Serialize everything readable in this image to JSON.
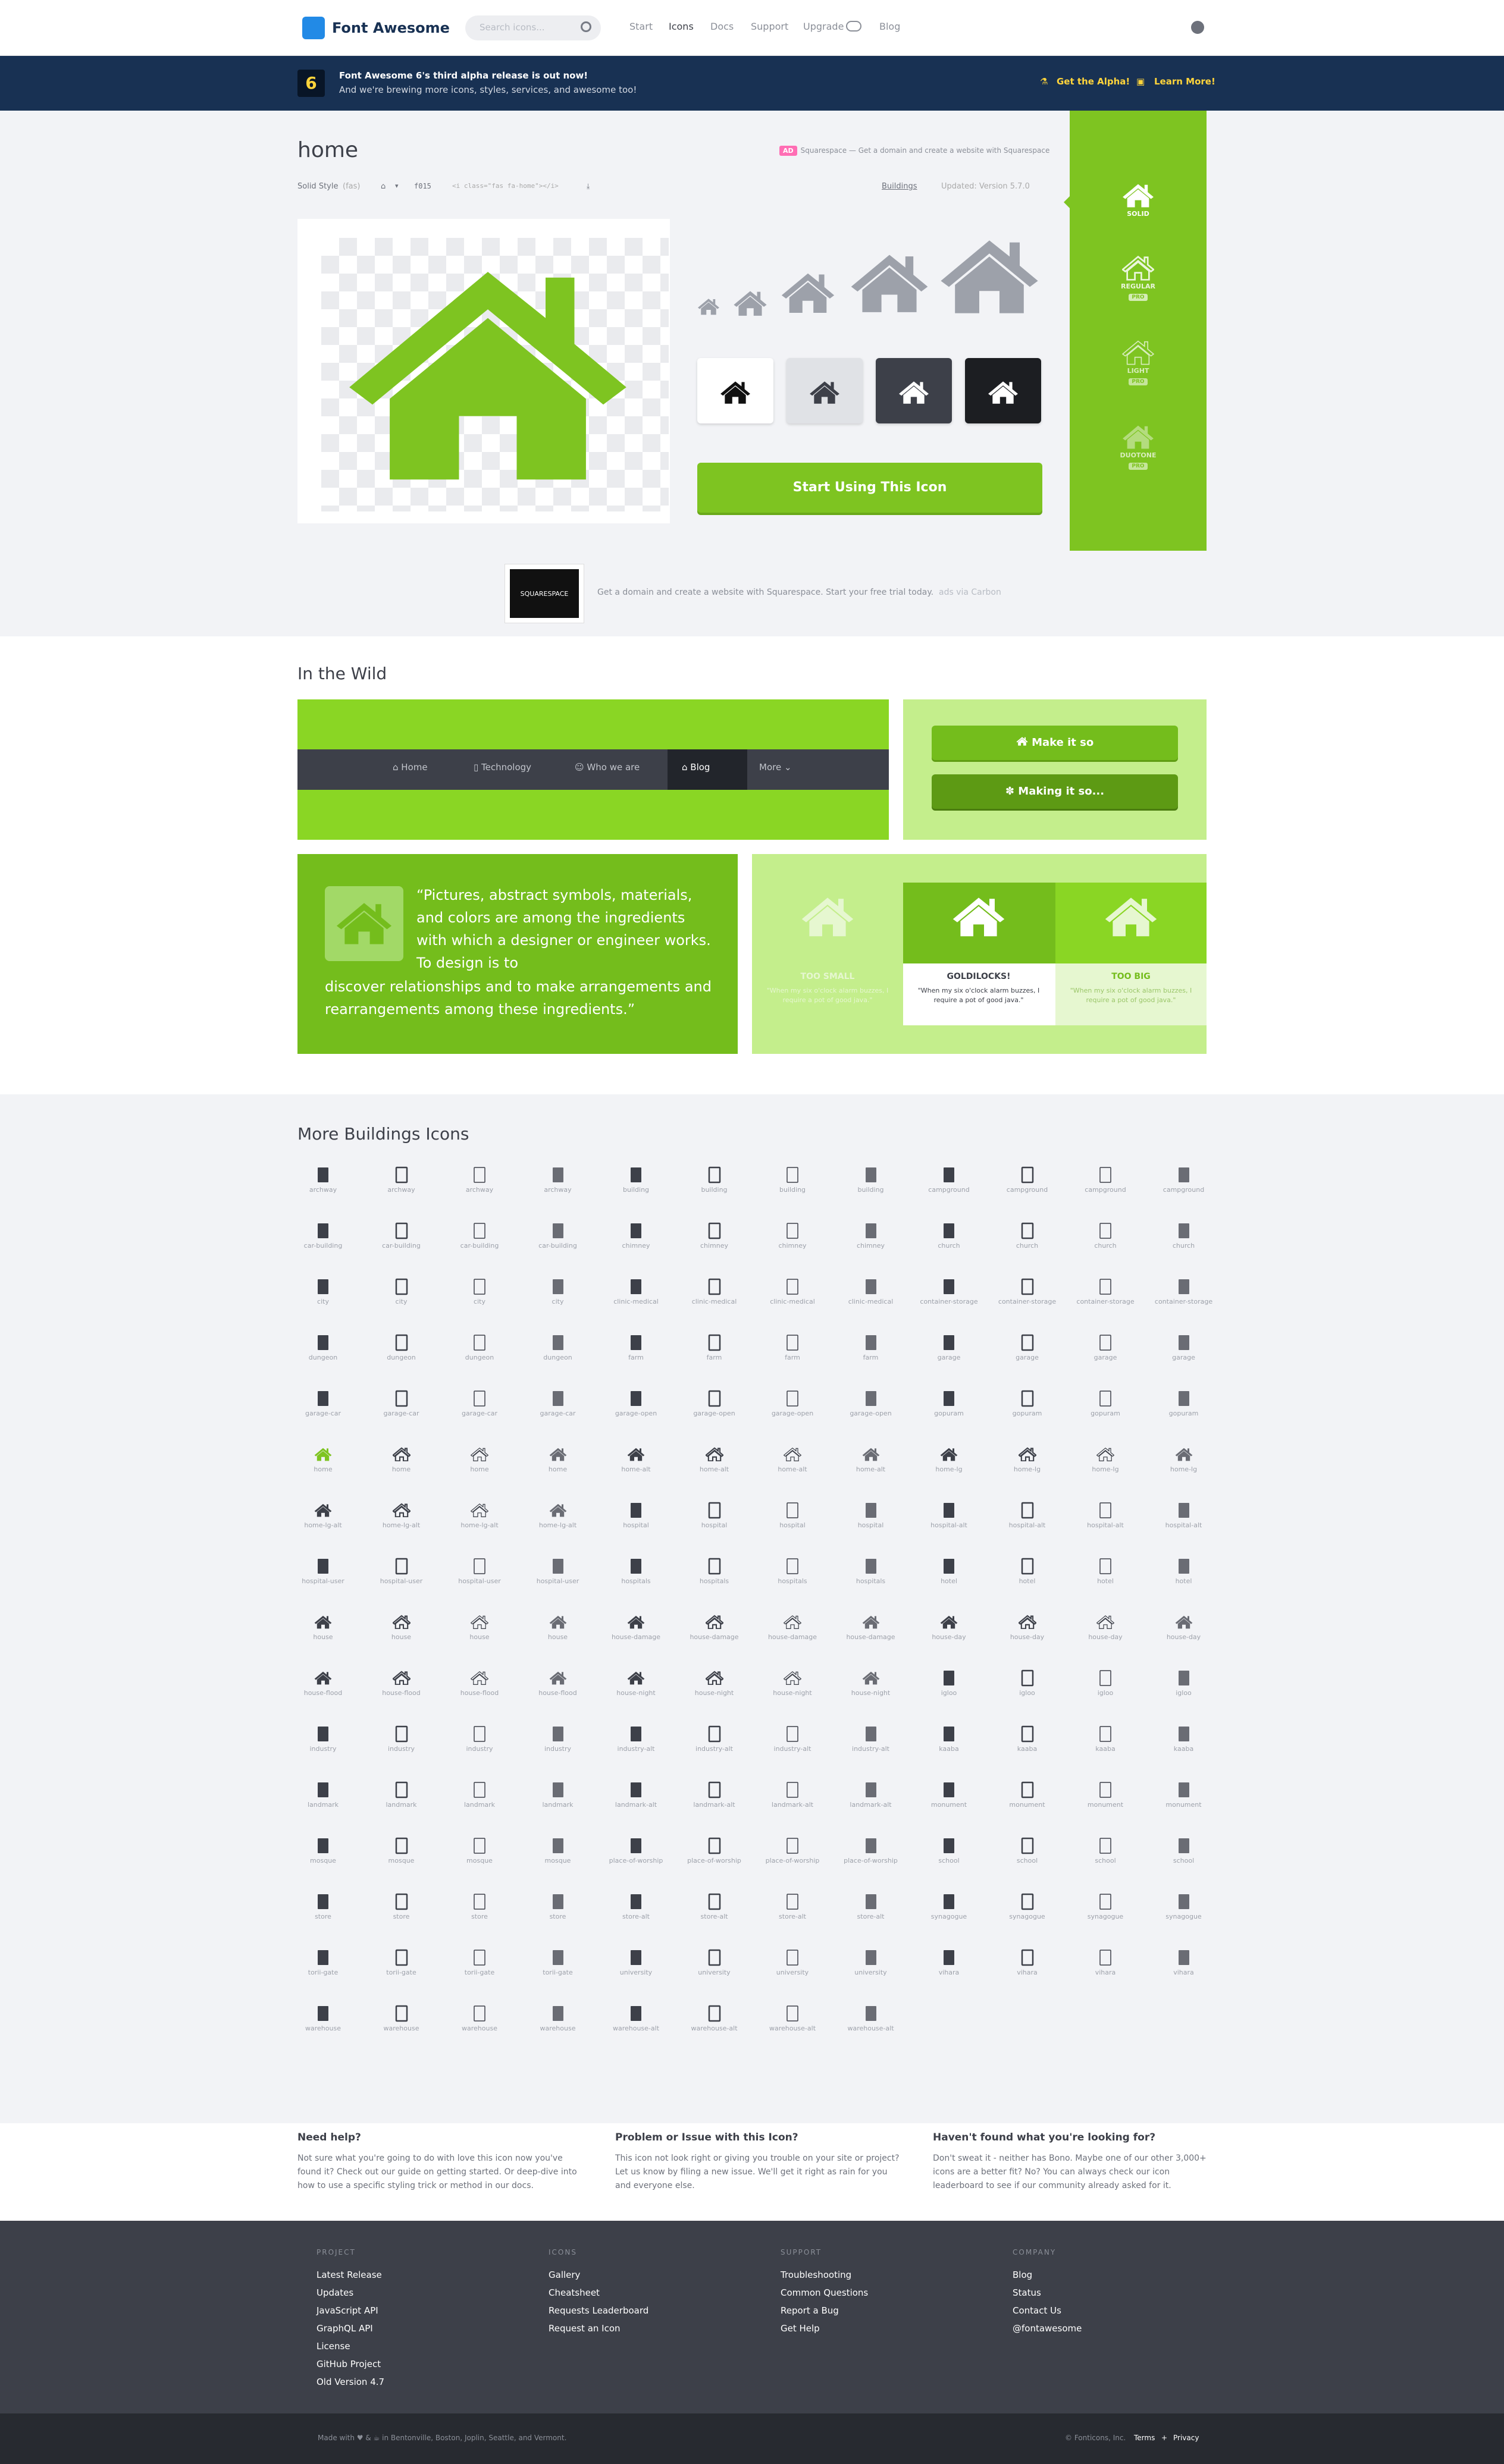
{
  "nav": {
    "brand": "Font Awesome",
    "search_placeholder": "Search icons...",
    "links": [
      "Start",
      "Icons",
      "Docs",
      "Support",
      "Upgrade",
      "Blog"
    ],
    "active": "Icons"
  },
  "banner": {
    "badge": "6",
    "title": "Font Awesome 6's third alpha release is out now!",
    "subtitle": "And we're brewing more icons, styles, services, and awesome too!",
    "cta1": "Get the Alpha!",
    "cta2": "Learn More!"
  },
  "detail": {
    "name": "home",
    "ad_badge": "AD",
    "ad_text": "Squarespace — Get a domain and create a website with Squarespace",
    "style": "Solid Style",
    "style_prefix": "(fas)",
    "unicode": "f015",
    "code": "<i class=\"fas fa-home\"></i>",
    "category": "Buildings",
    "updated": "Updated: Version 5.7.0",
    "cta": "Start Using This Icon",
    "sidebar": [
      {
        "label": "SOLID",
        "pro": ""
      },
      {
        "label": "REGULAR",
        "pro": "PRO"
      },
      {
        "label": "LIGHT",
        "pro": "PRO"
      },
      {
        "label": "DUOTONE",
        "pro": "PRO"
      }
    ],
    "carbon_logo": "SQUARESPACE",
    "carbon_text": "Get a domain and create a website with Squarespace. Start your free trial today.",
    "carbon_via": "ads via Carbon"
  },
  "wild": {
    "title": "In the Wild",
    "nav": [
      "Home",
      "Technology",
      "Who we are",
      "Blog",
      "More"
    ],
    "btn1": "Make it so",
    "btn2": "Making it so...",
    "quote_open": "“Pictures, abstract symbols, materials, and colors are among the ingredients with which a designer or engineer works. To design is to",
    "quote_close": "discover relationships and to make arrangements and rearrangements among these ingredients.”",
    "gold": [
      {
        "label": "TOO SMALL",
        "text": "\"When my six o'clock alarm buzzes, I require a pot of good java.\""
      },
      {
        "label": "GOLDILOCKS!",
        "text": "\"When my six o'clock alarm buzzes, I require a pot of good java.\""
      },
      {
        "label": "TOO BIG",
        "text": "\"When my six o'clock alarm buzzes, I require a pot of good java.\""
      }
    ]
  },
  "more": {
    "title": "More Buildings Icons",
    "icons": [
      "archway",
      "archway",
      "archway",
      "archway",
      "building",
      "building",
      "building",
      "building",
      "campground",
      "campground",
      "campground",
      "campground",
      "car-building",
      "car-building",
      "car-building",
      "car-building",
      "chimney",
      "chimney",
      "chimney",
      "chimney",
      "church",
      "church",
      "church",
      "church",
      "city",
      "city",
      "city",
      "city",
      "clinic-medical",
      "clinic-medical",
      "clinic-medical",
      "clinic-medical",
      "container-storage",
      "container-storage",
      "container-storage",
      "container-storage",
      "dungeon",
      "dungeon",
      "dungeon",
      "dungeon",
      "farm",
      "farm",
      "farm",
      "farm",
      "garage",
      "garage",
      "garage",
      "garage",
      "garage-car",
      "garage-car",
      "garage-car",
      "garage-car",
      "garage-open",
      "garage-open",
      "garage-open",
      "garage-open",
      "gopuram",
      "gopuram",
      "gopuram",
      "gopuram",
      "home",
      "home",
      "home",
      "home",
      "home-alt",
      "home-alt",
      "home-alt",
      "home-alt",
      "home-lg",
      "home-lg",
      "home-lg",
      "home-lg",
      "home-lg-alt",
      "home-lg-alt",
      "home-lg-alt",
      "home-lg-alt",
      "hospital",
      "hospital",
      "hospital",
      "hospital",
      "hospital-alt",
      "hospital-alt",
      "hospital-alt",
      "hospital-alt",
      "hospital-user",
      "hospital-user",
      "hospital-user",
      "hospital-user",
      "hospitals",
      "hospitals",
      "hospitals",
      "hospitals",
      "hotel",
      "hotel",
      "hotel",
      "hotel",
      "house",
      "house",
      "house",
      "house",
      "house-damage",
      "house-damage",
      "house-damage",
      "house-damage",
      "house-day",
      "house-day",
      "house-day",
      "house-day",
      "house-flood",
      "house-flood",
      "house-flood",
      "house-flood",
      "house-night",
      "house-night",
      "house-night",
      "house-night",
      "igloo",
      "igloo",
      "igloo",
      "igloo",
      "industry",
      "industry",
      "industry",
      "industry",
      "industry-alt",
      "industry-alt",
      "industry-alt",
      "industry-alt",
      "kaaba",
      "kaaba",
      "kaaba",
      "kaaba",
      "landmark",
      "landmark",
      "landmark",
      "landmark",
      "landmark-alt",
      "landmark-alt",
      "landmark-alt",
      "landmark-alt",
      "monument",
      "monument",
      "monument",
      "monument",
      "mosque",
      "mosque",
      "mosque",
      "mosque",
      "place-of-worship",
      "place-of-worship",
      "place-of-worship",
      "place-of-worship",
      "school",
      "school",
      "school",
      "school",
      "store",
      "store",
      "store",
      "store",
      "store-alt",
      "store-alt",
      "store-alt",
      "store-alt",
      "synagogue",
      "synagogue",
      "synagogue",
      "synagogue",
      "torii-gate",
      "torii-gate",
      "torii-gate",
      "torii-gate",
      "university",
      "university",
      "university",
      "university",
      "vihara",
      "vihara",
      "vihara",
      "vihara",
      "warehouse",
      "warehouse",
      "warehouse",
      "warehouse",
      "warehouse-alt",
      "warehouse-alt",
      "warehouse-alt",
      "warehouse-alt"
    ]
  },
  "help": [
    {
      "title": "Need help?",
      "text": "Not sure what you're going to do with love this icon now you've found it? Check out our guide on getting started. Or deep-dive into how to use a specific styling trick or method in our docs."
    },
    {
      "title": "Problem or Issue with this Icon?",
      "text": "This icon not look right or giving you trouble on your site or project? Let us know by filing a new issue. We'll get it right as rain for you and everyone else."
    },
    {
      "title": "Haven't found what you're looking for?",
      "text": "Don't sweat it - neither has Bono. Maybe one of our other 3,000+ icons are a better fit? No? You can always check our icon leaderboard to see if our community already asked for it."
    }
  ],
  "footer": {
    "cols": [
      {
        "title": "PROJECT",
        "links": [
          "Latest Release",
          "Updates",
          "JavaScript API",
          "GraphQL API",
          "License",
          "GitHub Project",
          "Old Version 4.7"
        ]
      },
      {
        "title": "ICONS",
        "links": [
          "Gallery",
          "Cheatsheet",
          "Requests Leaderboard",
          "Request an Icon"
        ]
      },
      {
        "title": "SUPPORT",
        "links": [
          "Troubleshooting",
          "Common Questions",
          "Report a Bug",
          "Get Help"
        ]
      },
      {
        "title": "COMPANY",
        "links": [
          "Blog",
          "Status",
          "Contact Us",
          "@fontawesome"
        ]
      }
    ],
    "made_with": "Made with ♥ & ☕ in Bentonville, Boston, Joplin, Seattle, and Vermont.",
    "copyright": "© Fonticons, Inc.",
    "terms": "Terms",
    "privacy": "Privacy"
  },
  "colors": {
    "accent": "#7ec421",
    "brand": "#228ae6",
    "banner": "#183153"
  }
}
